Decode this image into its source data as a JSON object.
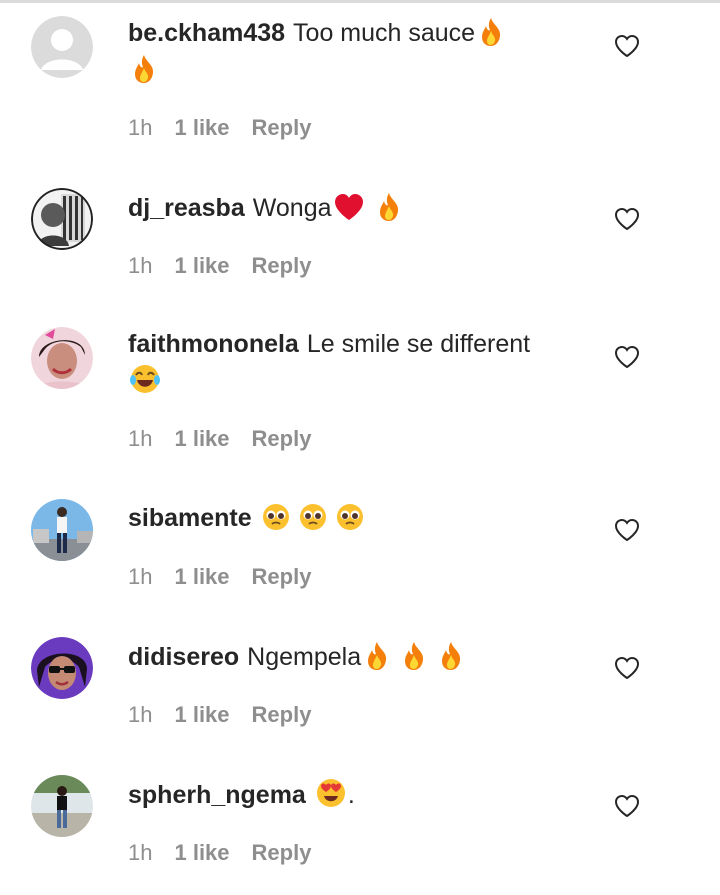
{
  "comments": [
    {
      "username": "be.ckham438",
      "text": "Too much sauce",
      "emojis": [
        "fire",
        "fire"
      ],
      "time": "1h",
      "likes": "1 like",
      "reply": "Reply",
      "avatar": "default-avatar"
    },
    {
      "username": "dj_reasba",
      "text": "Wonga",
      "emojis": [
        "red-heart",
        "fire"
      ],
      "time": "1h",
      "likes": "1 like",
      "reply": "Reply",
      "avatar": "profile-photo"
    },
    {
      "username": "faithmononela",
      "text": "Le smile se different",
      "emojis": [
        "tears-of-joy"
      ],
      "time": "1h",
      "likes": "1 like",
      "reply": "Reply",
      "avatar": "profile-photo"
    },
    {
      "username": "sibamente",
      "text": "",
      "emojis": [
        "pleading-face",
        "pleading-face",
        "pleading-face"
      ],
      "time": "1h",
      "likes": "1 like",
      "reply": "Reply",
      "avatar": "profile-photo"
    },
    {
      "username": "didisereo",
      "text": "Ngempela",
      "emojis": [
        "fire",
        "fire",
        "fire"
      ],
      "time": "1h",
      "likes": "1 like",
      "reply": "Reply",
      "avatar": "profile-photo"
    },
    {
      "username": "spherh_ngema",
      "text": "",
      "emojis": [
        "heart-eyes"
      ],
      "trailing": ".",
      "time": "1h",
      "likes": "1 like",
      "reply": "Reply",
      "avatar": "profile-photo"
    }
  ],
  "colors": {
    "username": "#262626",
    "meta": "#8e8e8e",
    "background": "#ffffff"
  }
}
